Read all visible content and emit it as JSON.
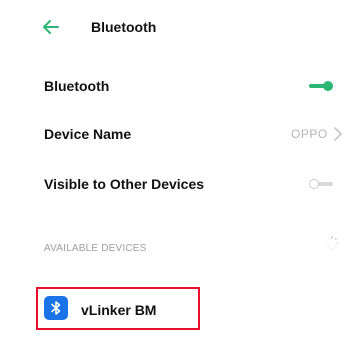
{
  "header": {
    "title": "Bluetooth",
    "back_icon": "arrow-left-icon",
    "accent_color": "#2bb673"
  },
  "settings": {
    "bluetooth": {
      "label": "Bluetooth",
      "enabled": true
    },
    "device_name": {
      "label": "Device Name",
      "value": "OPPO"
    },
    "visible": {
      "label": "Visible to Other Devices",
      "enabled": false
    }
  },
  "available": {
    "section_label": "AVAILABLE DEVICES",
    "scanning": true,
    "devices": [
      {
        "name": "vLinker BM",
        "icon": "bluetooth-icon",
        "icon_color": "#1a73e8",
        "highlighted": true,
        "highlight_color": "#e8102a"
      }
    ]
  }
}
